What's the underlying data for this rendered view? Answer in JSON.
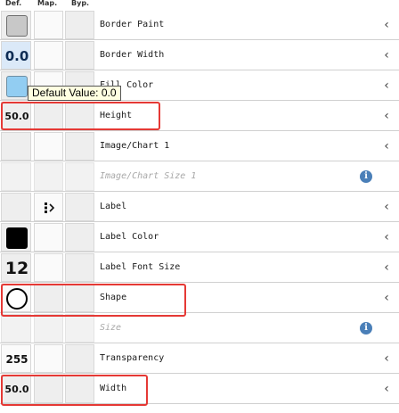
{
  "header": {
    "default_label": "Def.",
    "mapping_label": "Map.",
    "bypass_label": "Byp."
  },
  "properties": [
    {
      "label": "Border Paint",
      "default_kind": "color",
      "default_color": "#c8c8c8"
    },
    {
      "label": "Border Width",
      "default_kind": "text",
      "default_text": "0.0"
    },
    {
      "label": "Fill Color",
      "default_kind": "color",
      "default_color": "#92cdf2"
    },
    {
      "label": "Height",
      "default_kind": "text",
      "default_text": "50.0",
      "highlighted": true
    },
    {
      "label": "Image/Chart 1",
      "default_kind": "empty"
    },
    {
      "label": "Image/Chart Size 1",
      "default_kind": "empty",
      "disabled": true,
      "info": true
    },
    {
      "label": "Label",
      "default_kind": "empty",
      "mapping": "passthrough-mapping-icon"
    },
    {
      "label": "Label Color",
      "default_kind": "color",
      "default_color": "#000000"
    },
    {
      "label": "Label Font Size",
      "default_kind": "text",
      "default_text": "12"
    },
    {
      "label": "Shape",
      "default_kind": "shape",
      "shape": "ellipse",
      "highlighted": true
    },
    {
      "label": "Size",
      "default_kind": "empty",
      "disabled": true,
      "info": true
    },
    {
      "label": "Transparency",
      "default_kind": "text",
      "default_text": "255"
    },
    {
      "label": "Width",
      "default_kind": "text",
      "default_text": "50.0",
      "highlighted": true
    }
  ],
  "tooltip": {
    "text": "Default Value: 0.0"
  },
  "icons": {
    "expand": "chevron-left-icon",
    "info": "info-icon"
  },
  "colors": {
    "highlight": "#e53935",
    "info": "#4a7fb8"
  }
}
